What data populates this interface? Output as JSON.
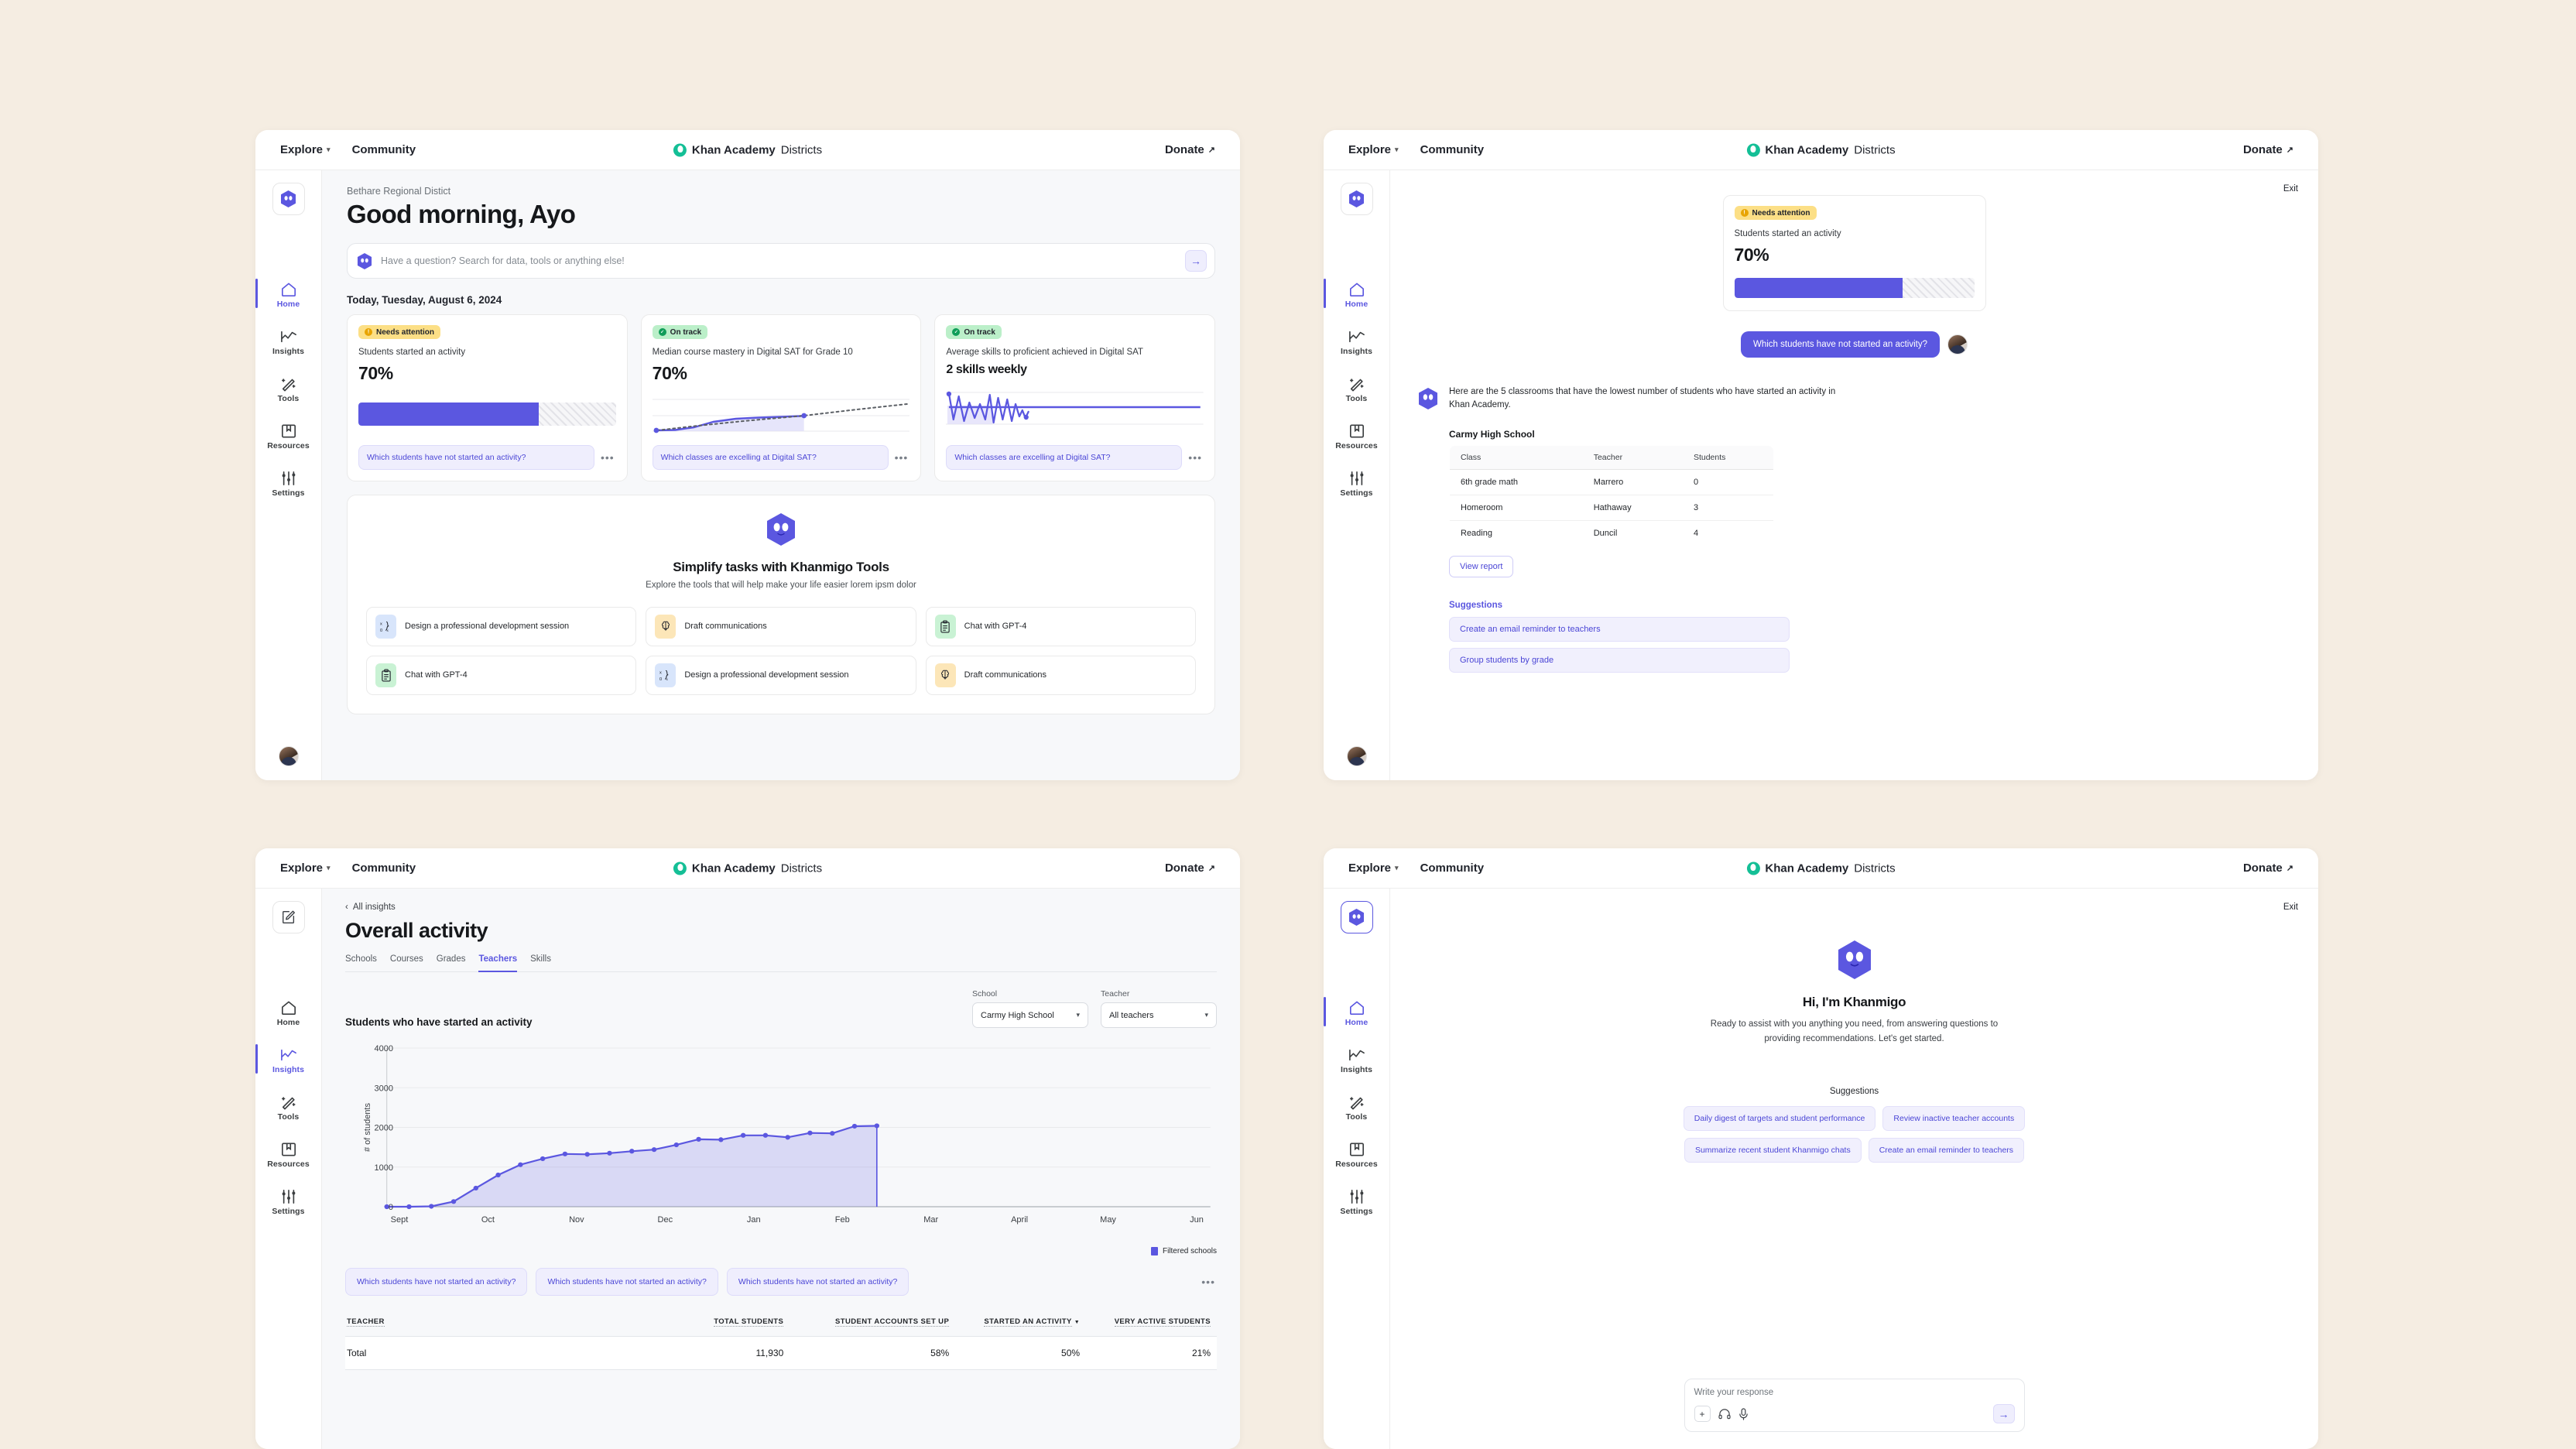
{
  "topnav": {
    "explore": "Explore",
    "community": "Community",
    "brand_bold": "Khan Academy",
    "brand_light": "Districts",
    "donate": "Donate"
  },
  "sidebar": {
    "items": [
      {
        "label": "Home",
        "icon": "home-icon"
      },
      {
        "label": "Insights",
        "icon": "insights-icon"
      },
      {
        "label": "Tools",
        "icon": "tools-icon"
      },
      {
        "label": "Resources",
        "icon": "resources-icon"
      },
      {
        "label": "Settings",
        "icon": "settings-icon"
      }
    ]
  },
  "home": {
    "district": "Bethare Regional Distict",
    "greeting": "Good morning, Ayo",
    "search_placeholder": "Have a question? Search for data, tools or anything else!",
    "today_label": "Today, Tuesday, August 6, 2024",
    "cards": [
      {
        "badge": "Needs attention",
        "badge_state": "warn",
        "label": "Students started an activity",
        "value": "70%",
        "viz": "progress",
        "progress_pct": 70,
        "chip": "Which students have not started an activity?"
      },
      {
        "badge": "On track",
        "badge_state": "ok",
        "label": "Median course mastery in Digital SAT for Grade 10",
        "value": "70%",
        "viz": "trend",
        "chip": "Which classes are excelling at Digital SAT?"
      },
      {
        "badge": "On track",
        "badge_state": "ok",
        "label": "Average skills to proficient achieved in Digital SAT",
        "value": "2 skills weekly",
        "viz": "volatile",
        "chip": "Which classes are excelling at Digital SAT?"
      }
    ],
    "tools": {
      "title": "Simplify tasks with Khanmigo Tools",
      "subtitle": "Explore the tools that will help make your life easier lorem ipsm dolor",
      "items": [
        {
          "label": "Design a professional development session",
          "icon": "math-formula-icon",
          "tone": "blue"
        },
        {
          "label": "Draft communications",
          "icon": "brain-icon",
          "tone": "amber"
        },
        {
          "label": "Chat with GPT-4",
          "icon": "clipboard-icon",
          "tone": "green"
        },
        {
          "label": "Chat with GPT-4",
          "icon": "clipboard-icon",
          "tone": "green"
        },
        {
          "label": "Design a professional development session",
          "icon": "math-formula-icon",
          "tone": "blue"
        },
        {
          "label": "Draft communications",
          "icon": "brain-icon",
          "tone": "amber"
        }
      ]
    }
  },
  "chat": {
    "exit": "Exit",
    "card": {
      "badge": "Needs attention",
      "label": "Students started an activity",
      "value": "70%",
      "progress_pct": 70
    },
    "user_message": "Which students have not started an activity?",
    "bot_message": "Here are the 5 classrooms that have the lowest number of students who have started an activity in Khan Academy.",
    "school_name": "Carmy High School",
    "table": {
      "columns": [
        "Class",
        "Teacher",
        "Students"
      ],
      "rows": [
        [
          "6th grade math",
          "Marrero",
          "0"
        ],
        [
          "Homeroom",
          "Hathaway",
          "3"
        ],
        [
          "Reading",
          "Duncil",
          "4"
        ]
      ]
    },
    "view_report": "View report",
    "suggestions_title": "Suggestions",
    "suggestions": [
      "Create an email reminder to teachers",
      "Group students by grade"
    ]
  },
  "insights": {
    "back": "All insights",
    "title": "Overall activity",
    "tabs": [
      {
        "label": "Schools",
        "active": false
      },
      {
        "label": "Courses",
        "active": false
      },
      {
        "label": "Grades",
        "active": false
      },
      {
        "label": "Teachers",
        "active": true
      },
      {
        "label": "Skills",
        "active": false
      }
    ],
    "chart_title": "Students who have started an activity",
    "filters": [
      {
        "label": "School",
        "value": "Carmy High School"
      },
      {
        "label": "Teacher",
        "value": "All teachers"
      }
    ],
    "question_chips": [
      "Which students have not started an activity?",
      "Which students have not started an activity?",
      "Which students have not started an activity?"
    ],
    "table": {
      "columns": [
        "TEACHER",
        "TOTAL STUDENTS",
        "STUDENT ACCOUNTS SET UP",
        "STARTED AN ACTIVITY",
        "VERY ACTIVE STUDENTS"
      ],
      "sorted_column_index": 3,
      "rows": [
        [
          "Total",
          "11,930",
          "58%",
          "50%",
          "21%"
        ]
      ]
    }
  },
  "chart_data": {
    "type": "area",
    "title": "Students who have started an activity",
    "xlabel": "",
    "ylabel": "# of students",
    "ylim": [
      0,
      4000
    ],
    "yticks": [
      0,
      1000,
      2000,
      3000,
      4000
    ],
    "xticks": [
      "Sept",
      "Oct",
      "Nov",
      "Dec",
      "Jan",
      "Feb",
      "Mar",
      "April",
      "May",
      "Jun"
    ],
    "grid": true,
    "legend_position": "bottom-right",
    "series": [
      {
        "name": "Filtered schools",
        "color": "#5B57E0",
        "values": [
          0,
          0,
          10,
          130,
          470,
          800,
          1060,
          1210,
          1330,
          1320,
          1350,
          1400,
          1440,
          1560,
          1700,
          1690,
          1800,
          1800,
          1750,
          1860,
          1850,
          2030,
          2040
        ]
      }
    ],
    "x_fraction_covered": 0.595
  },
  "khanmigo": {
    "exit": "Exit",
    "title": "Hi, I'm Khanmigo",
    "subtitle": "Ready to assist with you anything you need, from answering questions to providing recommendations. Let's get started.",
    "suggestions_label": "Suggestions",
    "suggestions": [
      "Daily digest of targets and student performance",
      "Review inactive teacher accounts",
      "Summarize recent student Khanmigo chats",
      "Create an email reminder to teachers"
    ],
    "composer_placeholder": "Write your response"
  },
  "colors": {
    "accent": "#5B57E0",
    "accent_soft": "#EFEEFD",
    "warn": "#FCDF86",
    "ok": "#BBEFC9",
    "page_bg": "#F5EDE2"
  }
}
